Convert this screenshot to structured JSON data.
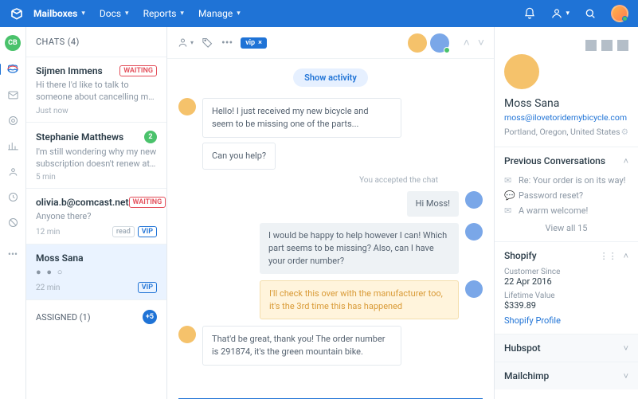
{
  "topbar": {
    "menu": [
      "Mailboxes",
      "Docs",
      "Reports",
      "Manage"
    ]
  },
  "sidebar": {
    "badge": "CB"
  },
  "chatlist": {
    "header": "CHATS",
    "count": "(4)",
    "chats": [
      {
        "name": "Sijmen Immens",
        "preview": "Hi there I'd like to talk to someone about cancelling my order :(",
        "time": "Just now",
        "badge": "WAITING"
      },
      {
        "name": "Stephanie Matthews",
        "preview": "I'm still wondering why my new subscription doesn't renew at the...",
        "time": "5 min",
        "unread": "2"
      },
      {
        "name": "olivia.b@comcast.net",
        "preview": "Anyone there?",
        "time": "12 min",
        "badge": "WAITING",
        "vip": "VIP",
        "read": "read"
      },
      {
        "name": "Moss Sana",
        "preview": "● ● ○",
        "time": "22 min",
        "vip": "VIP"
      }
    ],
    "assigned_header": "ASSIGNED",
    "assigned_count_paren": "(1)",
    "assigned_badge": "+5"
  },
  "convo": {
    "vip_chip": "vip",
    "activity": "Show activity",
    "system": "You accepted the chat",
    "msgs": {
      "m1": "Hello! I just received my new bicycle and seem to be missing one of the parts...",
      "m2": "Can you help?",
      "m3": "Hi Moss!",
      "m4": "I would be happy to help however I can! Which part seems to be missing? Also, can I have your order number?",
      "m5": "I'll check this over with the manufacturer too, it's the 3rd time this has happened",
      "m6": "That'd be great, thank you! The order number is 291874, it's the green mountain bike."
    }
  },
  "details": {
    "name": "Moss Sana",
    "email": "moss@ilovetoridemybicycle.com",
    "location": "Portland, Oregon, United States",
    "prev_header": "Previous Conversations",
    "prev": [
      {
        "icon": "mail",
        "text": "Re: Your order is on its way!"
      },
      {
        "icon": "chat",
        "text": "Password reset?"
      },
      {
        "icon": "mail",
        "text": "A warm welcome!"
      }
    ],
    "viewall": "View all 15",
    "shopify": {
      "title": "Shopify",
      "k1": "Customer Since",
      "v1": "22 Apr 2016",
      "k2": "Lifetime Value",
      "v2": "$339.89",
      "link": "Shopify Profile"
    },
    "hubspot": "Hubspot",
    "mailchimp": "Mailchimp"
  }
}
